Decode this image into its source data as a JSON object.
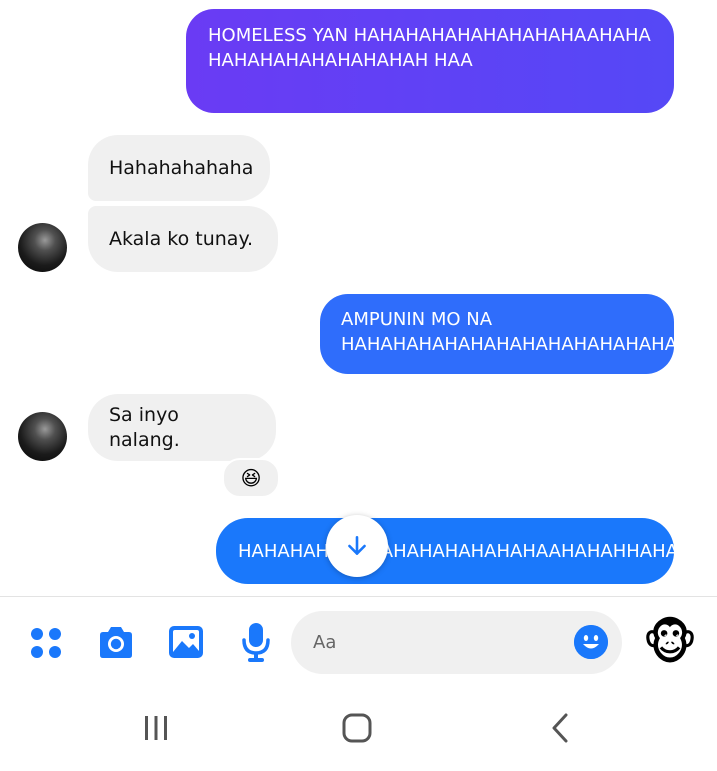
{
  "messages": [
    {
      "direction": "outgoing",
      "text": "HOMELESS YAN HAHAHAHAHAHAHAHAHAAHAHAHAHAHAHAHAHAHAHAH HAA"
    },
    {
      "direction": "incoming",
      "text": "Hahahahahaha"
    },
    {
      "direction": "incoming",
      "text": "Akala ko tunay."
    },
    {
      "direction": "outgoing",
      "text": "AMPUNIN MO NA HAHAHAHAHAHAHAHAHAHAHAHAHA"
    },
    {
      "direction": "incoming",
      "text": "Sa inyo nalang.",
      "reaction": "😆"
    },
    {
      "direction": "outgoing",
      "text": "HAHAHAHAHAHAHAHAHAHAHAHAAHAHAHHAHA"
    }
  ],
  "composer": {
    "placeholder": "Aa",
    "icons": [
      "apps-grid-icon",
      "camera-icon",
      "gallery-icon",
      "microphone-icon",
      "emoji-icon",
      "monkey-sticker-icon"
    ],
    "sticker": "🐵"
  },
  "navigation": {
    "icons": [
      "recent-apps-icon",
      "home-icon",
      "back-icon"
    ]
  },
  "colors": {
    "outgoing_gradient": [
      "#6a3bf4",
      "#5548f6"
    ],
    "outgoing_mid": "#2f6dfb",
    "outgoing_latest": "#1a78fb",
    "incoming": "#f0f0f0",
    "accent": "#1a78fb"
  }
}
